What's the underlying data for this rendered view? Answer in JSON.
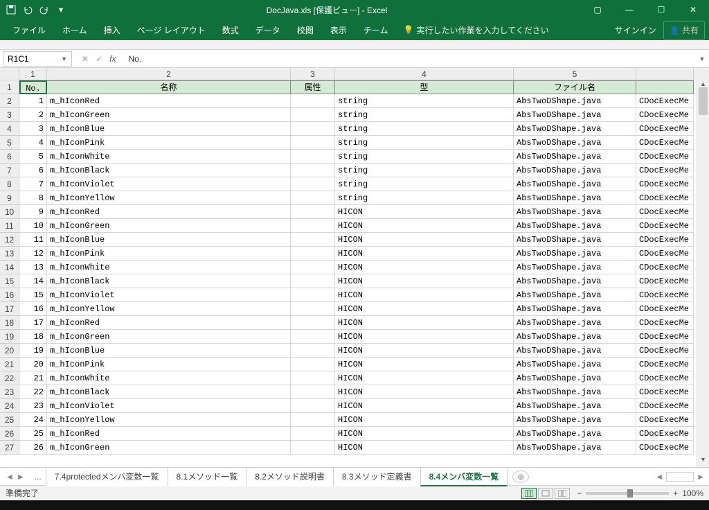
{
  "title": "DocJava.xls  [保護ビュー] - Excel",
  "qat": {
    "save": "save-icon",
    "undo": "undo-icon",
    "redo": "redo-icon",
    "customize": "▾"
  },
  "wincontrols": {
    "ribbonopts": "▢",
    "min": "—",
    "max": "☐",
    "close": "✕"
  },
  "ribbon": {
    "tabs": [
      "ファイル",
      "ホーム",
      "挿入",
      "ページ レイアウト",
      "数式",
      "データ",
      "校閲",
      "表示",
      "チーム"
    ],
    "tellme_icon": "💡",
    "tellme": "実行したい作業を入力してください",
    "signin": "サインイン",
    "share": "共有",
    "share_icon": "👤"
  },
  "formulabar": {
    "namebox": "R1C1",
    "cancel": "✕",
    "confirm": "✓",
    "fx": "fx",
    "value": "No."
  },
  "colheaders": [
    "1",
    "2",
    "3",
    "4",
    "5"
  ],
  "header_row": {
    "no": "No.",
    "name": "名称",
    "attr": "属性",
    "type": "型",
    "file": "ファイル名",
    "file2": ""
  },
  "rows": [
    {
      "n": "1",
      "name": "m_hIconRed",
      "attr": "",
      "type": "string",
      "file": "AbsTwoDShape.java",
      "f2": "CDocExecMe"
    },
    {
      "n": "2",
      "name": "m_hIconGreen",
      "attr": "",
      "type": "string",
      "file": "AbsTwoDShape.java",
      "f2": "CDocExecMe"
    },
    {
      "n": "3",
      "name": "m_hIconBlue",
      "attr": "",
      "type": "string",
      "file": "AbsTwoDShape.java",
      "f2": "CDocExecMe"
    },
    {
      "n": "4",
      "name": "m_hIconPink",
      "attr": "",
      "type": "string",
      "file": "AbsTwoDShape.java",
      "f2": "CDocExecMe"
    },
    {
      "n": "5",
      "name": "m_hIconWhite",
      "attr": "",
      "type": "string",
      "file": "AbsTwoDShape.java",
      "f2": "CDocExecMe"
    },
    {
      "n": "6",
      "name": "m_hIconBlack",
      "attr": "",
      "type": "string",
      "file": "AbsTwoDShape.java",
      "f2": "CDocExecMe"
    },
    {
      "n": "7",
      "name": "m_hIconViolet",
      "attr": "",
      "type": "string",
      "file": "AbsTwoDShape.java",
      "f2": "CDocExecMe"
    },
    {
      "n": "8",
      "name": "m_hIconYellow",
      "attr": "",
      "type": "string",
      "file": "AbsTwoDShape.java",
      "f2": "CDocExecMe"
    },
    {
      "n": "9",
      "name": "m_hIconRed",
      "attr": "",
      "type": "HICON",
      "file": "AbsTwoDShape.java",
      "f2": "CDocExecMe"
    },
    {
      "n": "10",
      "name": "m_hIconGreen",
      "attr": "",
      "type": "HICON",
      "file": "AbsTwoDShape.java",
      "f2": "CDocExecMe"
    },
    {
      "n": "11",
      "name": "m_hIconBlue",
      "attr": "",
      "type": "HICON",
      "file": "AbsTwoDShape.java",
      "f2": "CDocExecMe"
    },
    {
      "n": "12",
      "name": "m_hIconPink",
      "attr": "",
      "type": "HICON",
      "file": "AbsTwoDShape.java",
      "f2": "CDocExecMe"
    },
    {
      "n": "13",
      "name": "m_hIconWhite",
      "attr": "",
      "type": "HICON",
      "file": "AbsTwoDShape.java",
      "f2": "CDocExecMe"
    },
    {
      "n": "14",
      "name": "m_hIconBlack",
      "attr": "",
      "type": "HICON",
      "file": "AbsTwoDShape.java",
      "f2": "CDocExecMe"
    },
    {
      "n": "15",
      "name": "m_hIconViolet",
      "attr": "",
      "type": "HICON",
      "file": "AbsTwoDShape.java",
      "f2": "CDocExecMe"
    },
    {
      "n": "16",
      "name": "m_hIconYellow",
      "attr": "",
      "type": "HICON",
      "file": "AbsTwoDShape.java",
      "f2": "CDocExecMe"
    },
    {
      "n": "17",
      "name": "m_hIconRed",
      "attr": "",
      "type": "HICON",
      "file": "AbsTwoDShape.java",
      "f2": "CDocExecMe"
    },
    {
      "n": "18",
      "name": "m_hIconGreen",
      "attr": "",
      "type": "HICON",
      "file": "AbsTwoDShape.java",
      "f2": "CDocExecMe"
    },
    {
      "n": "19",
      "name": "m_hIconBlue",
      "attr": "",
      "type": "HICON",
      "file": "AbsTwoDShape.java",
      "f2": "CDocExecMe"
    },
    {
      "n": "20",
      "name": "m_hIconPink",
      "attr": "",
      "type": "HICON",
      "file": "AbsTwoDShape.java",
      "f2": "CDocExecMe"
    },
    {
      "n": "21",
      "name": "m_hIconWhite",
      "attr": "",
      "type": "HICON",
      "file": "AbsTwoDShape.java",
      "f2": "CDocExecMe"
    },
    {
      "n": "22",
      "name": "m_hIconBlack",
      "attr": "",
      "type": "HICON",
      "file": "AbsTwoDShape.java",
      "f2": "CDocExecMe"
    },
    {
      "n": "23",
      "name": "m_hIconViolet",
      "attr": "",
      "type": "HICON",
      "file": "AbsTwoDShape.java",
      "f2": "CDocExecMe"
    },
    {
      "n": "24",
      "name": "m_hIconYellow",
      "attr": "",
      "type": "HICON",
      "file": "AbsTwoDShape.java",
      "f2": "CDocExecMe"
    },
    {
      "n": "25",
      "name": "m_hIconRed",
      "attr": "",
      "type": "HICON",
      "file": "AbsTwoDShape.java",
      "f2": "CDocExecMe"
    },
    {
      "n": "26",
      "name": "m_hIconGreen",
      "attr": "",
      "type": "HICON",
      "file": "AbsTwoDShape.java",
      "f2": "CDocExecMe"
    }
  ],
  "sheettabs": {
    "dots": "...",
    "tabs": [
      {
        "label": "7.4protectedメンバ変数一覧",
        "active": false
      },
      {
        "label": "8.1メソッド一覧",
        "active": false
      },
      {
        "label": "8.2メソッド説明書",
        "active": false
      },
      {
        "label": "8.3メソッド定義書",
        "active": false
      },
      {
        "label": "8.4メンバ変数一覧",
        "active": true
      }
    ],
    "add": "⊕"
  },
  "statusbar": {
    "ready": "準備完了",
    "zoom": "100%",
    "minus": "−",
    "plus": "+"
  }
}
